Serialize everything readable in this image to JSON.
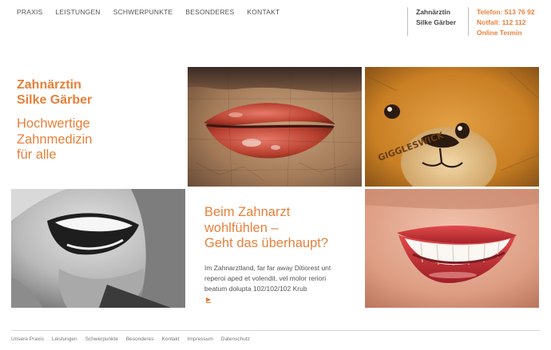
{
  "nav": {
    "items": [
      {
        "label": "PRAXIS"
      },
      {
        "label": "LEISTUNGEN"
      },
      {
        "label": "SCHWERPUNKTE"
      },
      {
        "label": "BESONDERES"
      },
      {
        "label": "KONTAKT"
      }
    ]
  },
  "header": {
    "name_line1": "Zahnärztin",
    "name_line2": "Silke Gärber",
    "phone": "Telefon: 513 76 92",
    "emergency": "Notfall: 112 112",
    "online_appointment": "Online Termin"
  },
  "hero": {
    "title_line1": "Zahnärztin",
    "title_line2": "Silke Gärber",
    "subtitle_line1": "Hochwertige",
    "subtitle_line2": "Zahnmedizin",
    "subtitle_line3": "für alle"
  },
  "feature": {
    "title_line1": "Beim Zahnarzt",
    "title_line2": "wohlfühlen –",
    "title_line3": "Geht das überhaupt?",
    "body_line1": "Im Zahnarztland, far far away Ditiorest unt",
    "body_line2": "reperoi aped et volendit, vel molor reriori",
    "body_line3": "beatum dolupta 102/102/102 Krub",
    "more_arrow": "▶"
  },
  "footer": {
    "items": [
      {
        "label": "Unsere Praxis"
      },
      {
        "label": "Leistungen"
      },
      {
        "label": "Schwerpunkte"
      },
      {
        "label": "Besonderes"
      },
      {
        "label": "Kontakt"
      },
      {
        "label": "Impressum"
      },
      {
        "label": "Datenschutz"
      }
    ]
  },
  "images": {
    "lips_painting": "painted-lips-image",
    "teddy_bear": "teddy-bear-image",
    "laughing_man": "laughing-man-image",
    "smiling_mouth": "smiling-mouth-image"
  },
  "colors": {
    "accent": "#e8803a",
    "text": "#555555",
    "divider": "#bdbdbd"
  }
}
